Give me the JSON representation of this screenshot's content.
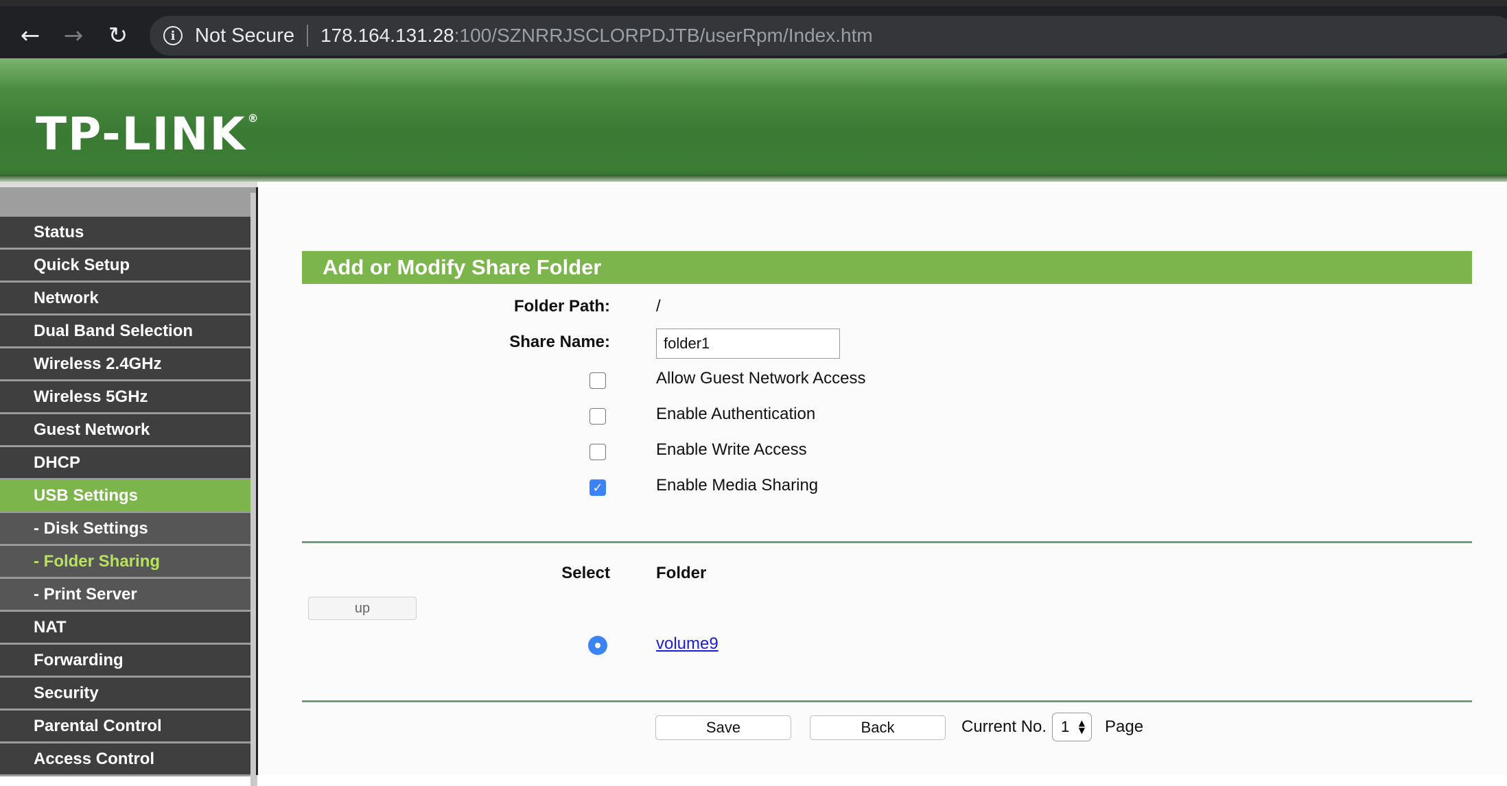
{
  "browser": {
    "security_label": "Not Secure",
    "url_host": "178.164.131.28",
    "url_rest": ":100/SZNRRJSCLORPDJTB/userRpm/Index.htm"
  },
  "header": {
    "logo_text": "TP-LINK",
    "logo_mark": "®"
  },
  "sidebar": {
    "items": [
      {
        "label": "Status"
      },
      {
        "label": "Quick Setup"
      },
      {
        "label": "Network"
      },
      {
        "label": "Dual Band Selection"
      },
      {
        "label": "Wireless 2.4GHz"
      },
      {
        "label": "Wireless 5GHz"
      },
      {
        "label": "Guest Network"
      },
      {
        "label": "DHCP"
      },
      {
        "label": "USB Settings"
      },
      {
        "label": "- Disk Settings"
      },
      {
        "label": "- Folder Sharing"
      },
      {
        "label": "- Print Server"
      },
      {
        "label": "NAT"
      },
      {
        "label": "Forwarding"
      },
      {
        "label": "Security"
      },
      {
        "label": "Parental Control"
      },
      {
        "label": "Access Control"
      }
    ],
    "active": "USB Settings",
    "active_sub": "- Folder Sharing"
  },
  "form": {
    "title": "Add or Modify Share Folder",
    "folder_path_label": "Folder Path:",
    "folder_path_value": "/",
    "share_name_label": "Share Name:",
    "share_name_value": "folder1",
    "options": [
      {
        "label": "Allow Guest Network Access",
        "checked": false
      },
      {
        "label": "Enable Authentication",
        "checked": false
      },
      {
        "label": "Enable Write Access",
        "checked": false
      },
      {
        "label": "Enable Media Sharing",
        "checked": true
      }
    ]
  },
  "folder_table": {
    "col_select": "Select",
    "col_folder": "Folder",
    "up_button": "up",
    "rows": [
      {
        "folder": "volume9",
        "selected": true
      }
    ]
  },
  "footer": {
    "save_label": "Save",
    "back_label": "Back",
    "current_no_label": "Current No.",
    "page_value": "1",
    "page_label": "Page"
  }
}
